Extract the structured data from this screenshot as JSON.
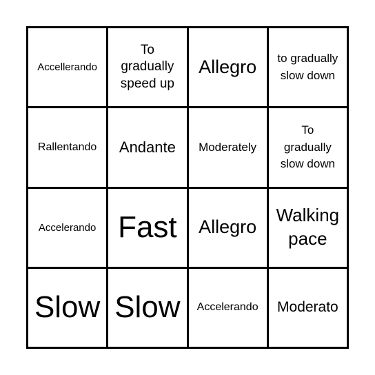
{
  "card": {
    "cells": [
      {
        "text": "Accellerando"
      },
      {
        "text": "To gradually speed up"
      },
      {
        "text": "Allegro"
      },
      {
        "text": "to gradually slow down"
      },
      {
        "text": "Rallentando"
      },
      {
        "text": "Andante"
      },
      {
        "text": "Moderately"
      },
      {
        "text": "To gradually slow down"
      },
      {
        "text": "Accelerando"
      },
      {
        "text": "Fast"
      },
      {
        "text": "Allegro"
      },
      {
        "text": "Walking pace"
      },
      {
        "text": "Slow"
      },
      {
        "text": "Slow"
      },
      {
        "text": "Accelerando"
      },
      {
        "text": "Moderato"
      }
    ]
  }
}
